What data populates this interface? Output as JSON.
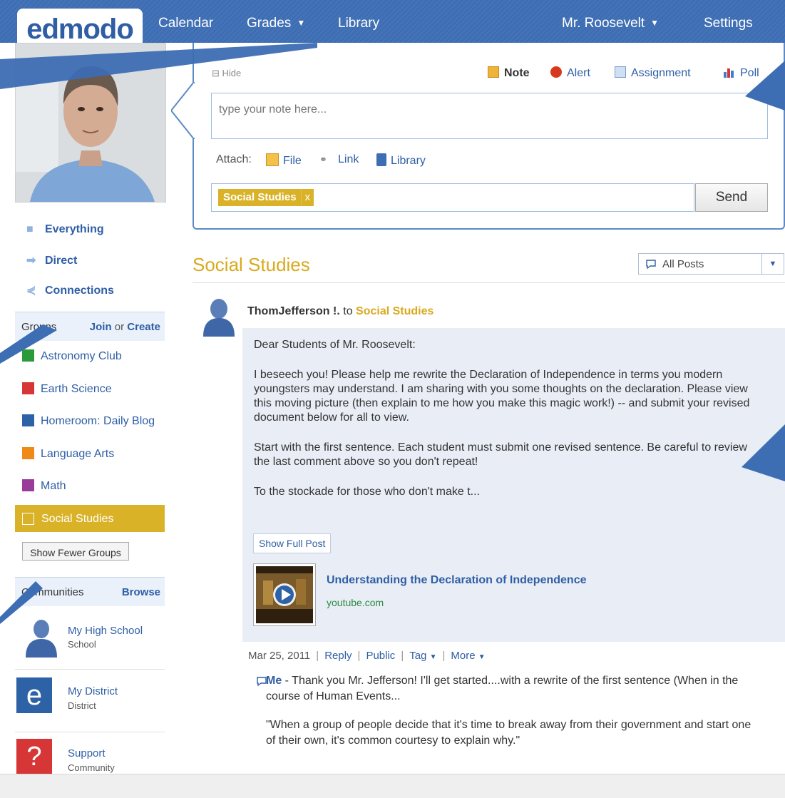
{
  "nav": {
    "logo": "edmodo",
    "calendar": "Calendar",
    "grades": "Grades",
    "library": "Library",
    "user": "Mr. Roosevelt",
    "settings": "Settings"
  },
  "composer": {
    "hide": "Hide",
    "types": [
      "Note",
      "Alert",
      "Assignment",
      "Poll"
    ],
    "placeholder": "type your note here...",
    "attach_label": "Attach:",
    "attach": [
      "File",
      "Link",
      "Library"
    ],
    "recipient": "Social Studies",
    "recipient_remove": "x",
    "send": "Send"
  },
  "sidebar": {
    "nav": [
      "Everything",
      "Direct",
      "Connections"
    ],
    "groups_header": "Groups",
    "join": "Join",
    "or": "or",
    "create": "Create",
    "groups": [
      {
        "name": "Astronomy Club",
        "color": "#2a9a3a"
      },
      {
        "name": "Earth Science",
        "color": "#d63636"
      },
      {
        "name": "Homeroom: Daily Blog",
        "color": "#2e62a6"
      },
      {
        "name": "Language Arts",
        "color": "#ef8a16"
      },
      {
        "name": "Math",
        "color": "#9a3d9a"
      }
    ],
    "active_group": "Social Studies",
    "show_fewer": "Show Fewer Groups",
    "communities_header": "Communities",
    "browse": "Browse",
    "communities": [
      {
        "name": "My High School",
        "type": "School"
      },
      {
        "name": "My District",
        "type": "District"
      },
      {
        "name": "Support",
        "type": "Community"
      }
    ]
  },
  "stream": {
    "title": "Social Studies",
    "filter": "All Posts",
    "post": {
      "author": "ThomJefferson !.",
      "to": "to",
      "group": "Social Studies",
      "paragraphs": [
        "Dear Students of Mr. Roosevelt:",
        "I beseech you! Please help me rewrite the Declaration of Independence in terms you modern youngsters may understand. I am sharing with you some thoughts on the declaration. Please view this moving picture (then explain to me how you make this magic work!) -- and submit your revised document below for all to view.",
        "Start with the first sentence. Each student must submit one revised sentence. Be careful to review the last comment above so you don't repeat!",
        "To the stockade for those who don't make t..."
      ],
      "show_full": "Show Full Post",
      "video_title": "Understanding the Declaration of Independence",
      "video_source": "youtube.com",
      "date": "Mar 25, 2011",
      "reply": "Reply",
      "public": "Public",
      "tag": "Tag",
      "more": "More"
    },
    "comment": {
      "author": "Me",
      "text": " - Thank you Mr. Jefferson! I'll get started....with a rewrite of the first sentence (When in the course of Human Events...",
      "quote": "\"When a group of people decide that it's time to break away from their government and start one of their own, it's common courtesy to explain why.\""
    }
  }
}
